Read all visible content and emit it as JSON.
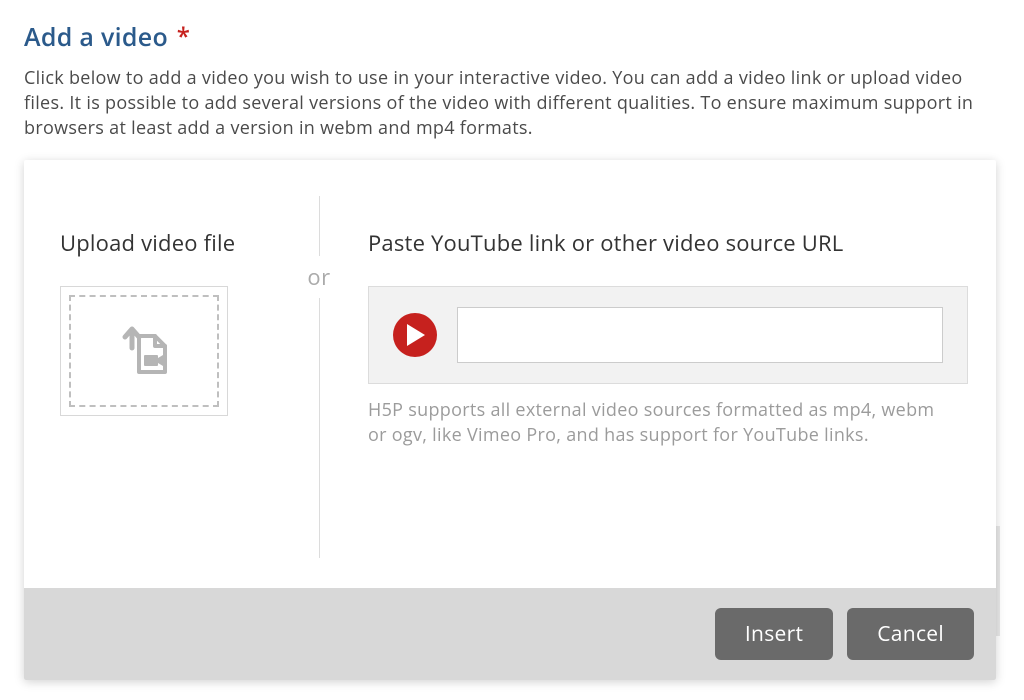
{
  "header": {
    "title": "Add a video",
    "required_marker": "*",
    "description": "Click below to add a video you wish to use in your interactive video. You can add a video link or upload video files. It is possible to add several versions of the video with different qualities. To ensure maximum support in browsers at least add a version in webm and mp4 formats."
  },
  "dialog": {
    "upload_heading": "Upload video file",
    "divider_label": "or",
    "url_heading": "Paste YouTube link or other video source URL",
    "url_input_value": "",
    "url_input_placeholder": "",
    "support_text": "H5P supports all external video sources formatted as mp4, webm or ogv, like Vimeo Pro, and has support for YouTube links.",
    "buttons": {
      "insert": "Insert",
      "cancel": "Cancel"
    }
  }
}
